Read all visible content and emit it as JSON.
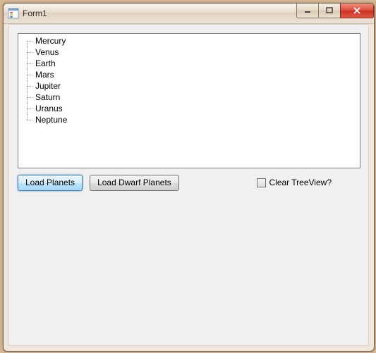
{
  "window": {
    "title": "Form1"
  },
  "treeview": {
    "nodes": [
      {
        "label": "Mercury"
      },
      {
        "label": "Venus"
      },
      {
        "label": "Earth"
      },
      {
        "label": "Mars"
      },
      {
        "label": "Jupiter"
      },
      {
        "label": "Saturn"
      },
      {
        "label": "Uranus"
      },
      {
        "label": "Neptune"
      }
    ]
  },
  "buttons": {
    "load_planets": "Load Planets",
    "load_dwarf_planets": "Load Dwarf Planets"
  },
  "checkbox": {
    "clear_treeview_label": "Clear TreeView?",
    "clear_treeview_checked": false
  }
}
